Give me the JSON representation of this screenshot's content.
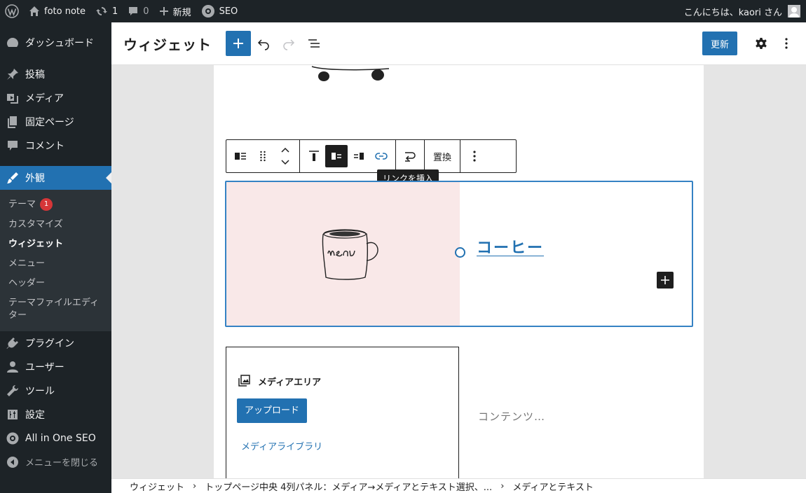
{
  "adminbar": {
    "site_name": "foto note",
    "updates_count": "1",
    "comments_count": "0",
    "new_label": "新規",
    "seo_label": "SEO",
    "greeting": "こんにちは、kaori さん"
  },
  "sidebar": {
    "dashboard": "ダッシュボード",
    "posts": "投稿",
    "media": "メディア",
    "pages": "固定ページ",
    "comments": "コメント",
    "appearance": "外観",
    "submenu": {
      "themes": "テーマ",
      "themes_badge": "1",
      "customize": "カスタマイズ",
      "widgets": "ウィジェット",
      "menus": "メニュー",
      "header": "ヘッダー",
      "theme_editor": "テーマファイルエディター"
    },
    "plugins": "プラグイン",
    "users": "ユーザー",
    "tools": "ツール",
    "settings": "設定",
    "aioseo": "All in One SEO",
    "collapse": "メニューを閉じる"
  },
  "header": {
    "title": "ウィジェット",
    "update_label": "更新"
  },
  "toolbar": {
    "replace_label": "置換",
    "tooltip": "リンクを挿入"
  },
  "media_text": {
    "heading": "コーヒー"
  },
  "placeholder": {
    "label": "メディアエリア",
    "upload_label": "アップロード",
    "library_label": "メディアライブラリ",
    "content_placeholder": "コンテンツ…"
  },
  "breadcrumbs": [
    "ウィジェット",
    "トップページ中央 4列パネル：メディア→メディアとテキスト選択、...",
    "メディアとテキスト"
  ]
}
